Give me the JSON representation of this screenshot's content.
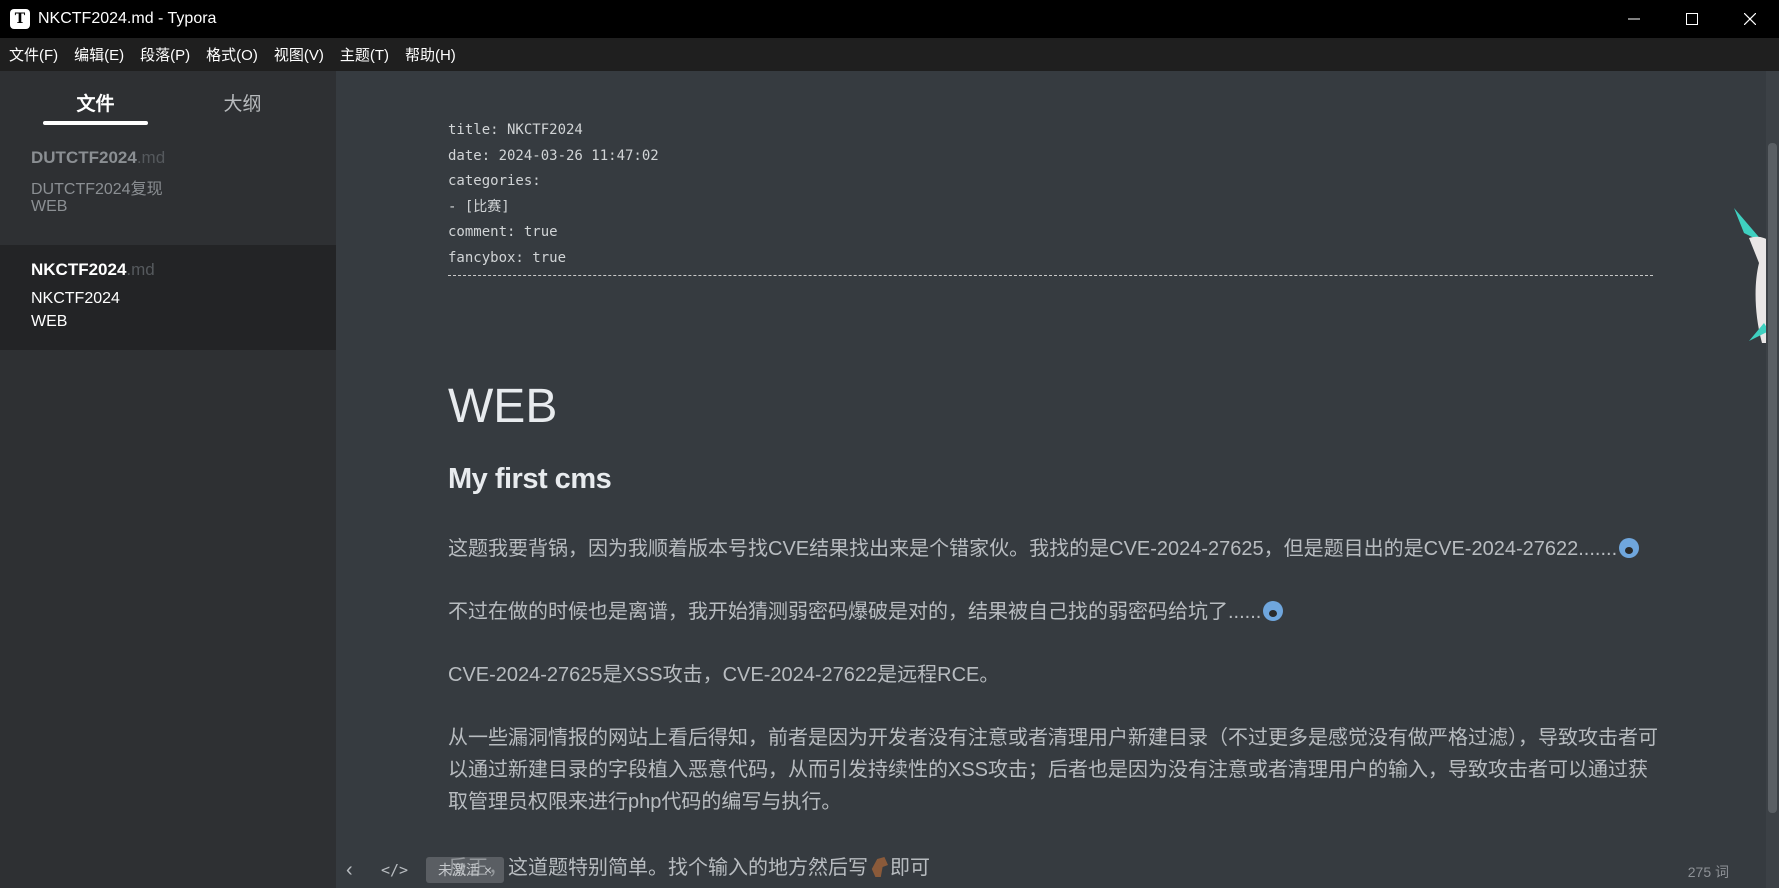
{
  "window": {
    "icon_letter": "T",
    "title": "NKCTF2024.md - Typora",
    "minimize": "—",
    "maximize": "☐",
    "close": "✕"
  },
  "menu": [
    "文件(F)",
    "编辑(E)",
    "段落(P)",
    "格式(O)",
    "视图(V)",
    "主题(T)",
    "帮助(H)"
  ],
  "sidebar": {
    "tabs": [
      "文件",
      "大纲"
    ],
    "files": [
      {
        "name": "DUTCTF2024",
        "ext": ".md",
        "lines": [
          "DUTCTF2024复现",
          "WEB"
        ]
      },
      {
        "name": "NKCTF2024",
        "ext": ".md",
        "lines": [
          "NKCTF2024",
          "WEB"
        ]
      }
    ]
  },
  "editor": {
    "frontmatter": [
      "title: NKCTF2024",
      "date: 2024-03-26 11:47:02",
      "categories:",
      "- [比赛]",
      "comment: true",
      "fancybox: true"
    ],
    "h1": "WEB",
    "h2": "My first cms",
    "p1": "这题我要背锅，因为我顺着版本号找CVE结果找出来是个错家伙。我找的是CVE-2024-27625，但是题目出的是CVE-2024-27622.......",
    "p2": "不过在做的时候也是离谱，我开始猜测弱密码爆破是对的，结果被自己找的弱密码给坑了......",
    "p3": "CVE-2024-27625是XSS攻击，CVE-2024-27622是远程RCE。",
    "p4": "从一些漏洞情报的网站上看后得知，前者是因为开发者没有注意或者清理用户新建目录（不过更多是感觉没有做严格过滤），导致攻击者可以通过新建目录的字段植入恶意代码，从而引发持续性的XSS攻击；后者也是因为没有注意或者清理用户的输入，导致攻击者可以通过获取管理员权限来进行php代码的编写与执行。",
    "p5_a": "反正，这道题特别简单。找个输入的地方然后写",
    "p5_b": "即可"
  },
  "statusbar": {
    "back": "‹",
    "code": "</>",
    "badge": "未激活 ×",
    "words": "275 词"
  }
}
